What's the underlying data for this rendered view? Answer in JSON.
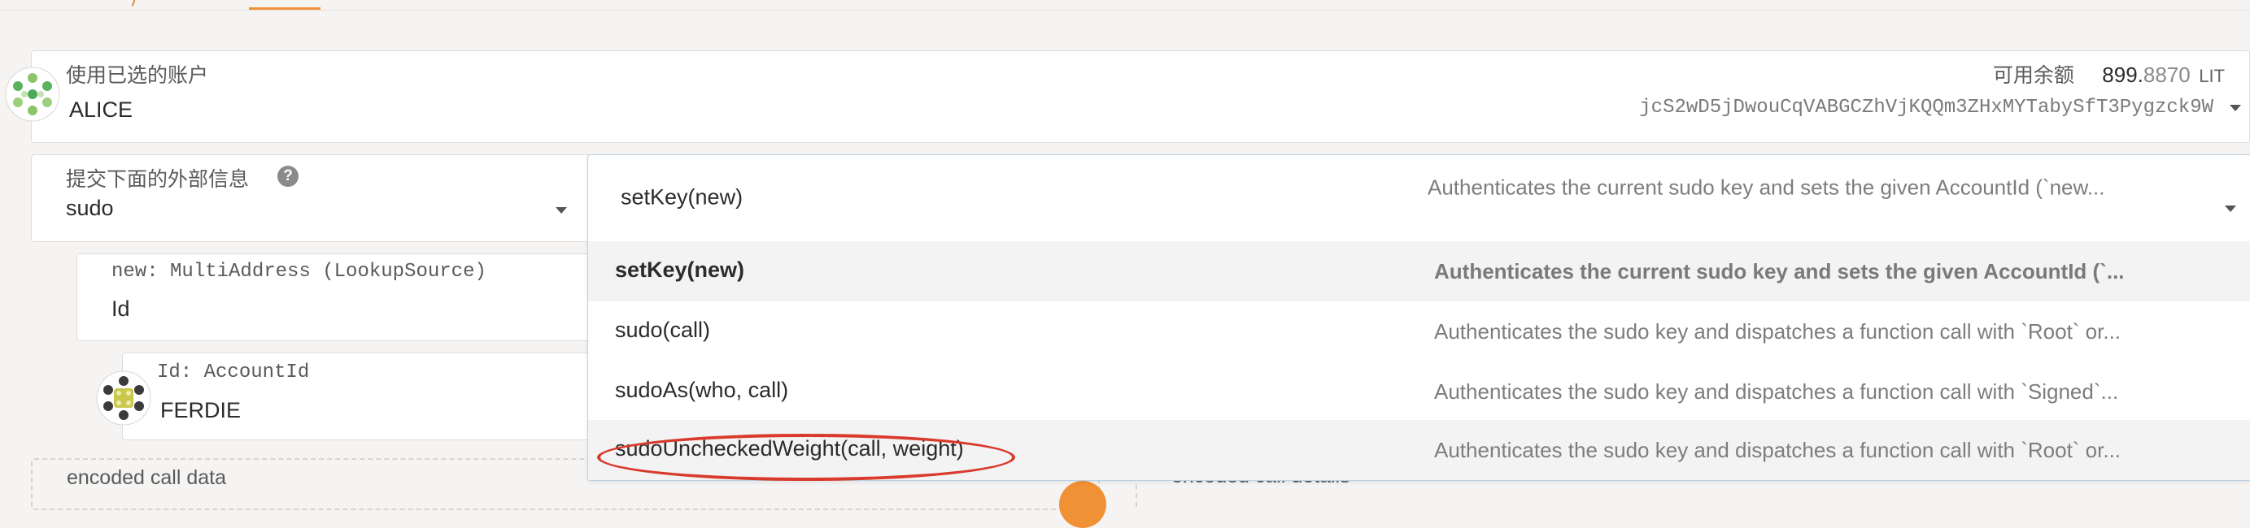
{
  "account": {
    "label": "使用已选的账户",
    "name": "ALICE",
    "balance_label": "可用余额",
    "balance_int": "899.",
    "balance_dec": "8870",
    "balance_unit": "LIT",
    "address": "jcS2wD5jDwouCqVABGCZhVjKQQm3ZHxMYTabySfT3Pygzck9W"
  },
  "extrinsic": {
    "label": "提交下面的外部信息",
    "help": "?",
    "module": "sudo"
  },
  "param_new": {
    "label": "new: MultiAddress (LookupSource)",
    "value": "Id"
  },
  "param_id": {
    "label": "Id: AccountId",
    "value": "FERDIE"
  },
  "encoded": {
    "label": "encoded call data",
    "details_label": "encoded call details"
  },
  "dropdown": {
    "selected": {
      "name": "setKey(new)",
      "desc": "Authenticates the current sudo key and sets the given AccountId (`new..."
    },
    "options": [
      {
        "name": "setKey(new)",
        "desc": "Authenticates the current sudo key and sets the given AccountId (`..."
      },
      {
        "name": "sudo(call)",
        "desc": "Authenticates the sudo key and dispatches a function call with `Root` or..."
      },
      {
        "name": "sudoAs(who, call)",
        "desc": "Authenticates the sudo key and dispatches a function call with `Signed`..."
      },
      {
        "name": "sudoUncheckedWeight(call, weight)",
        "desc": "Authenticates the sudo key and dispatches a function call with `Root` or..."
      }
    ]
  },
  "colors": {
    "accent": "#f19135",
    "highlight_circle": "#d93a2b",
    "dropdown_border": "#b9d2e6"
  }
}
